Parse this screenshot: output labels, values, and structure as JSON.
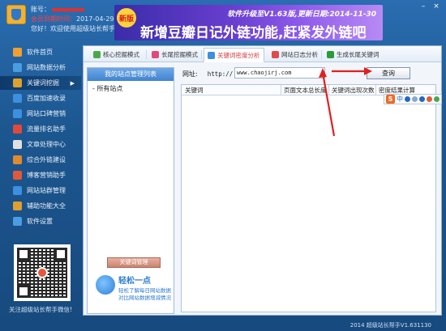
{
  "header": {
    "account_label": "账号：",
    "expiry_label": "会员到期时间：",
    "expiry_date": "2017-04-29",
    "welcome": "您好！欢迎使用超级站长帮手"
  },
  "banner": {
    "badge": "新版",
    "top_line": "软件升级至V1.63版,更新日期:2014-11-30",
    "main_line": "新增豆瓣日记外链功能,赶紧发外链吧"
  },
  "window_controls": [
    "–",
    "×"
  ],
  "sidebar": {
    "items": [
      {
        "label": "软件首页",
        "icon": "home-icon",
        "color": "#f0a030"
      },
      {
        "label": "网站数据分析",
        "icon": "chart-icon",
        "color": "#4a9de0"
      },
      {
        "label": "关键词挖掘",
        "icon": "key-icon",
        "color": "#e0a030",
        "active": true
      },
      {
        "label": "百度加速收录",
        "icon": "rocket-icon",
        "color": "#3d8fe0"
      },
      {
        "label": "网站口碑营销",
        "icon": "megaphone-icon",
        "color": "#3d8fe0"
      },
      {
        "label": "流量排名助手",
        "icon": "rank-icon",
        "color": "#e04a3a"
      },
      {
        "label": "文章处理中心",
        "icon": "doc-icon",
        "color": "#e0e0e0"
      },
      {
        "label": "综合外链建设",
        "icon": "link-icon",
        "color": "#e08a30"
      },
      {
        "label": "博客营销助手",
        "icon": "blog-icon",
        "color": "#e05a3a"
      },
      {
        "label": "网站站群管理",
        "icon": "sites-icon",
        "color": "#3d8fe0"
      },
      {
        "label": "辅助功能大全",
        "icon": "tools-icon",
        "color": "#e0a030"
      },
      {
        "label": "软件设置",
        "icon": "gear-icon",
        "color": "#4a9de0"
      }
    ],
    "qr_caption": "关注超级站长帮手微信!"
  },
  "tabs": [
    {
      "label": "核心挖掘模式",
      "icon_color": "#4aa84a"
    },
    {
      "label": "长尾挖掘模式",
      "icon_color": "#e04a7a"
    },
    {
      "label": "关键词密度分析",
      "icon_color": "#3d8fe0",
      "active": true
    },
    {
      "label": "网站日志分析",
      "icon_color": "#e04a4a"
    },
    {
      "label": "生成长尾关键词",
      "icon_color": "#2a9a3a"
    }
  ],
  "site_panel": {
    "title": "我的站点管理列表",
    "tree_root": "所有站点",
    "manage_button": "关键词管理",
    "easy_title": "轻松一点",
    "easy_line1": "轻松了解每日网站数据",
    "easy_line2": "对比网站数据增减情况"
  },
  "url_bar": {
    "label": "网址:",
    "prefix": "http://",
    "value": "www.chaojirj.com",
    "query_button": "查询"
  },
  "grid": {
    "columns": [
      "关键词",
      "页面文本总长度",
      "关键词出现次数",
      "密度结果计算"
    ]
  },
  "ime": {
    "logo": "S",
    "mode": "中"
  },
  "status": {
    "version": "2014 超级站长帮手V1.631130"
  }
}
